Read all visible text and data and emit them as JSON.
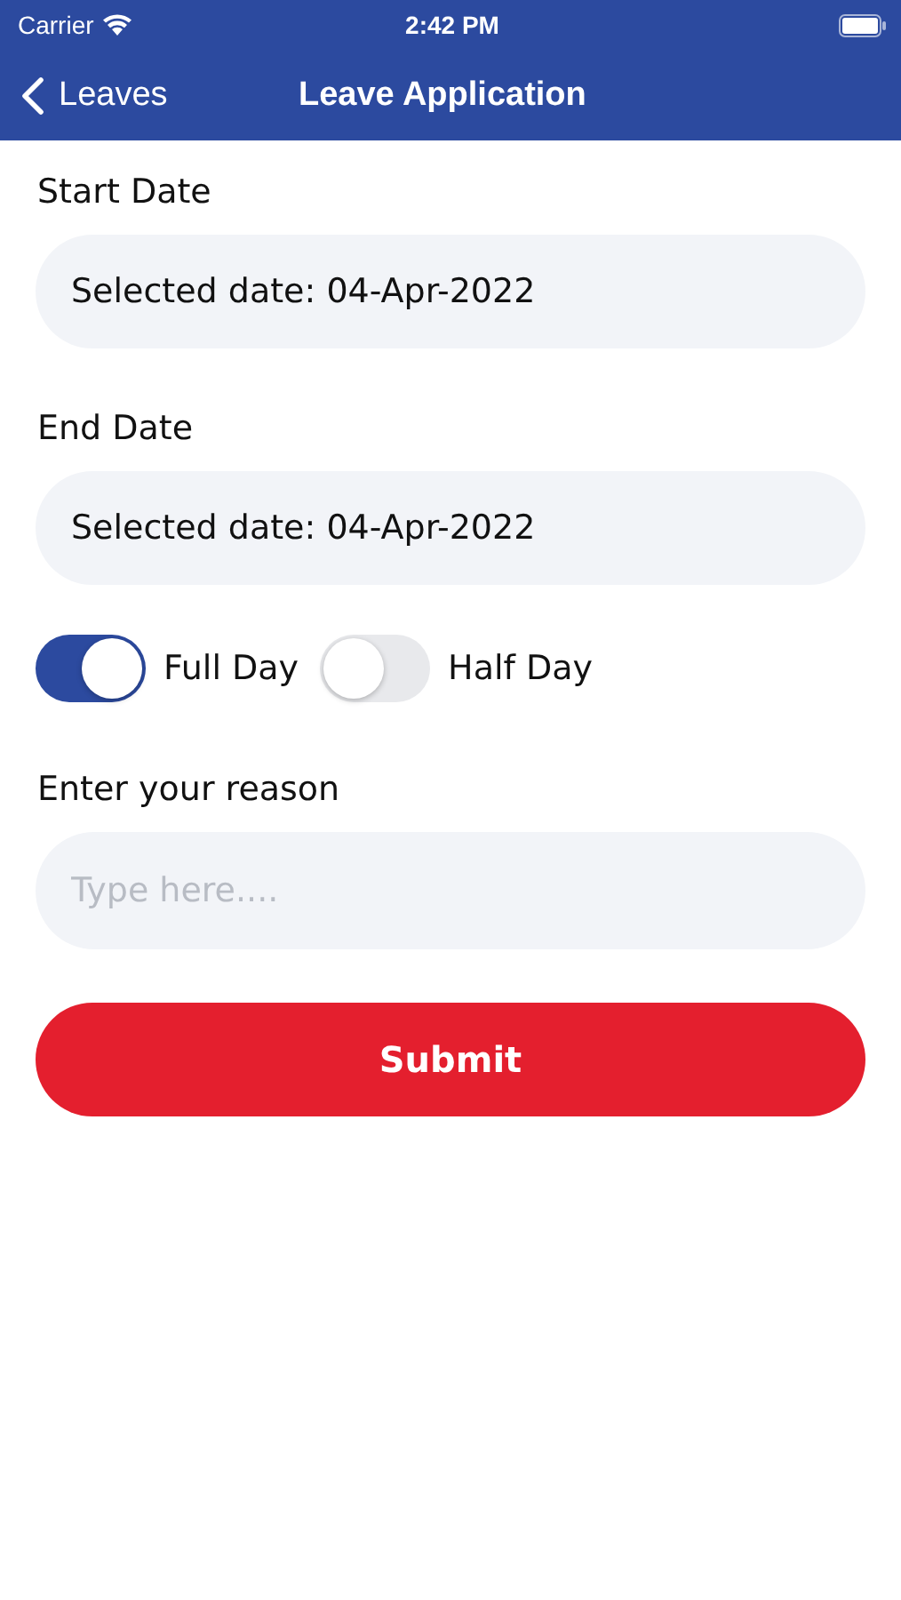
{
  "status_bar": {
    "carrier": "Carrier",
    "time": "2:42 PM"
  },
  "nav_bar": {
    "back_label": "Leaves",
    "title": "Leave Application"
  },
  "start_date": {
    "label": "Start Date",
    "value": "Selected date: 04-Apr-2022"
  },
  "end_date": {
    "label": "End Date",
    "value": "Selected date: 04-Apr-2022"
  },
  "day_options": [
    {
      "label": "Full Day",
      "on": true
    },
    {
      "label": "Half Day",
      "on": false
    }
  ],
  "reason": {
    "label": "Enter your reason",
    "placeholder": "Type here...."
  },
  "submit": {
    "label": "Submit"
  }
}
